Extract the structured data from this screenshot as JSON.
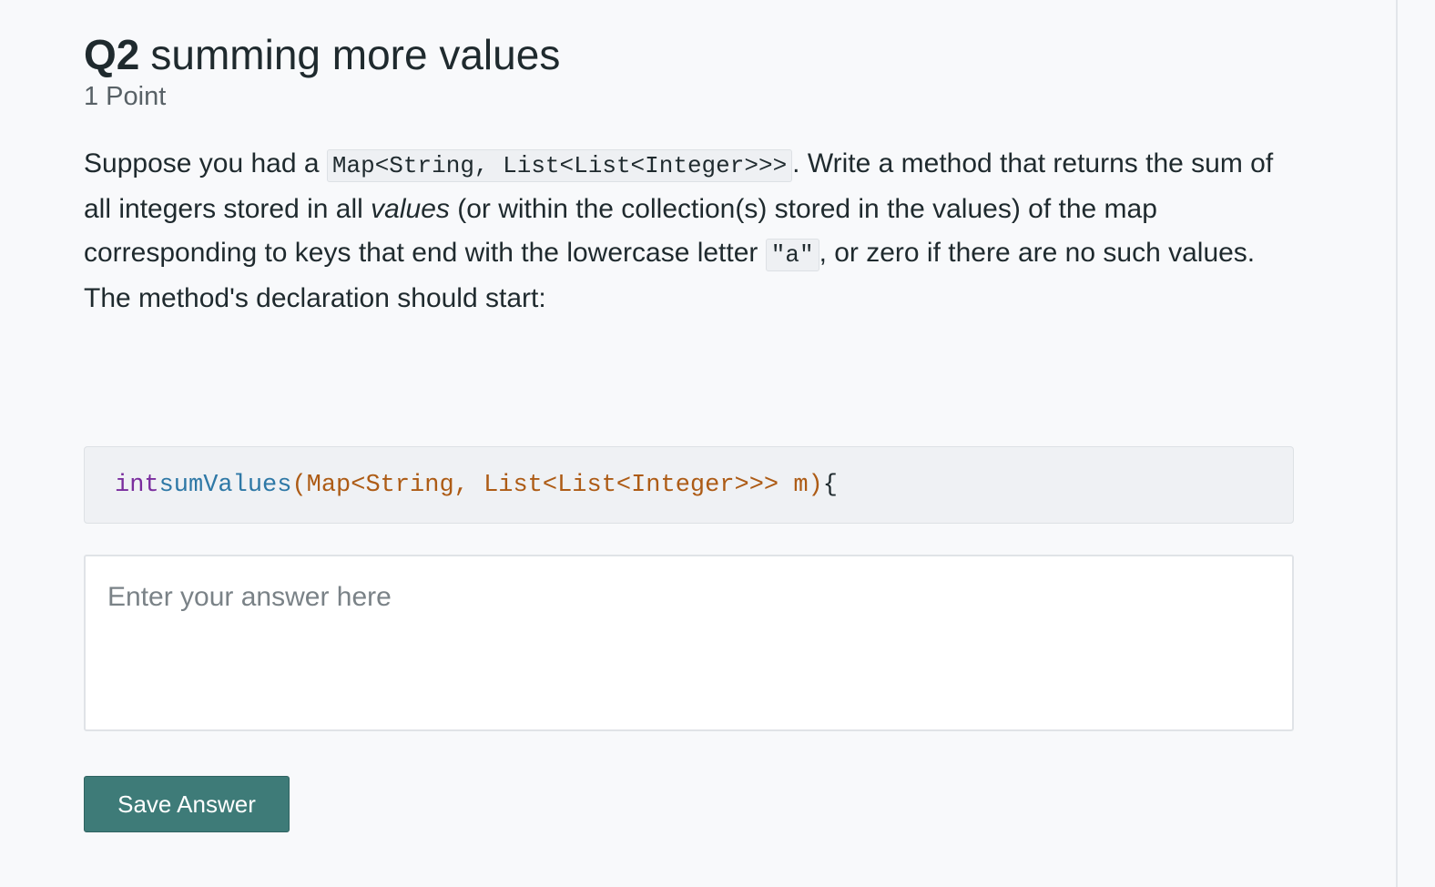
{
  "question": {
    "number": "Q2",
    "title": "summing more values",
    "points": "1 Point",
    "prompt": {
      "part1": "Suppose you had a ",
      "code_type": "Map<String, List<List<Integer>>>",
      "part2": ". Write a method that returns the sum of all integers stored in all ",
      "emphasis": "values",
      "part3": " (or within the collection(s) stored in the values) of the map corresponding to keys that end with the lowercase letter ",
      "code_letter": "\"a\"",
      "part4": ", or zero if there are no such values."
    },
    "declaration_label": "The method's declaration should start:",
    "declaration_code": {
      "keyword": "int",
      "function_name": "sumValues",
      "params": "(Map<String, List<List<Integer>>> m)",
      "brace": "{"
    }
  },
  "answer": {
    "placeholder": "Enter your answer here",
    "value": ""
  },
  "save_button": {
    "label": "Save Answer"
  },
  "colors": {
    "accent": "#3e7b78",
    "keyword": "#7a2d9e",
    "function": "#2e78a6",
    "type": "#ad5b15"
  }
}
